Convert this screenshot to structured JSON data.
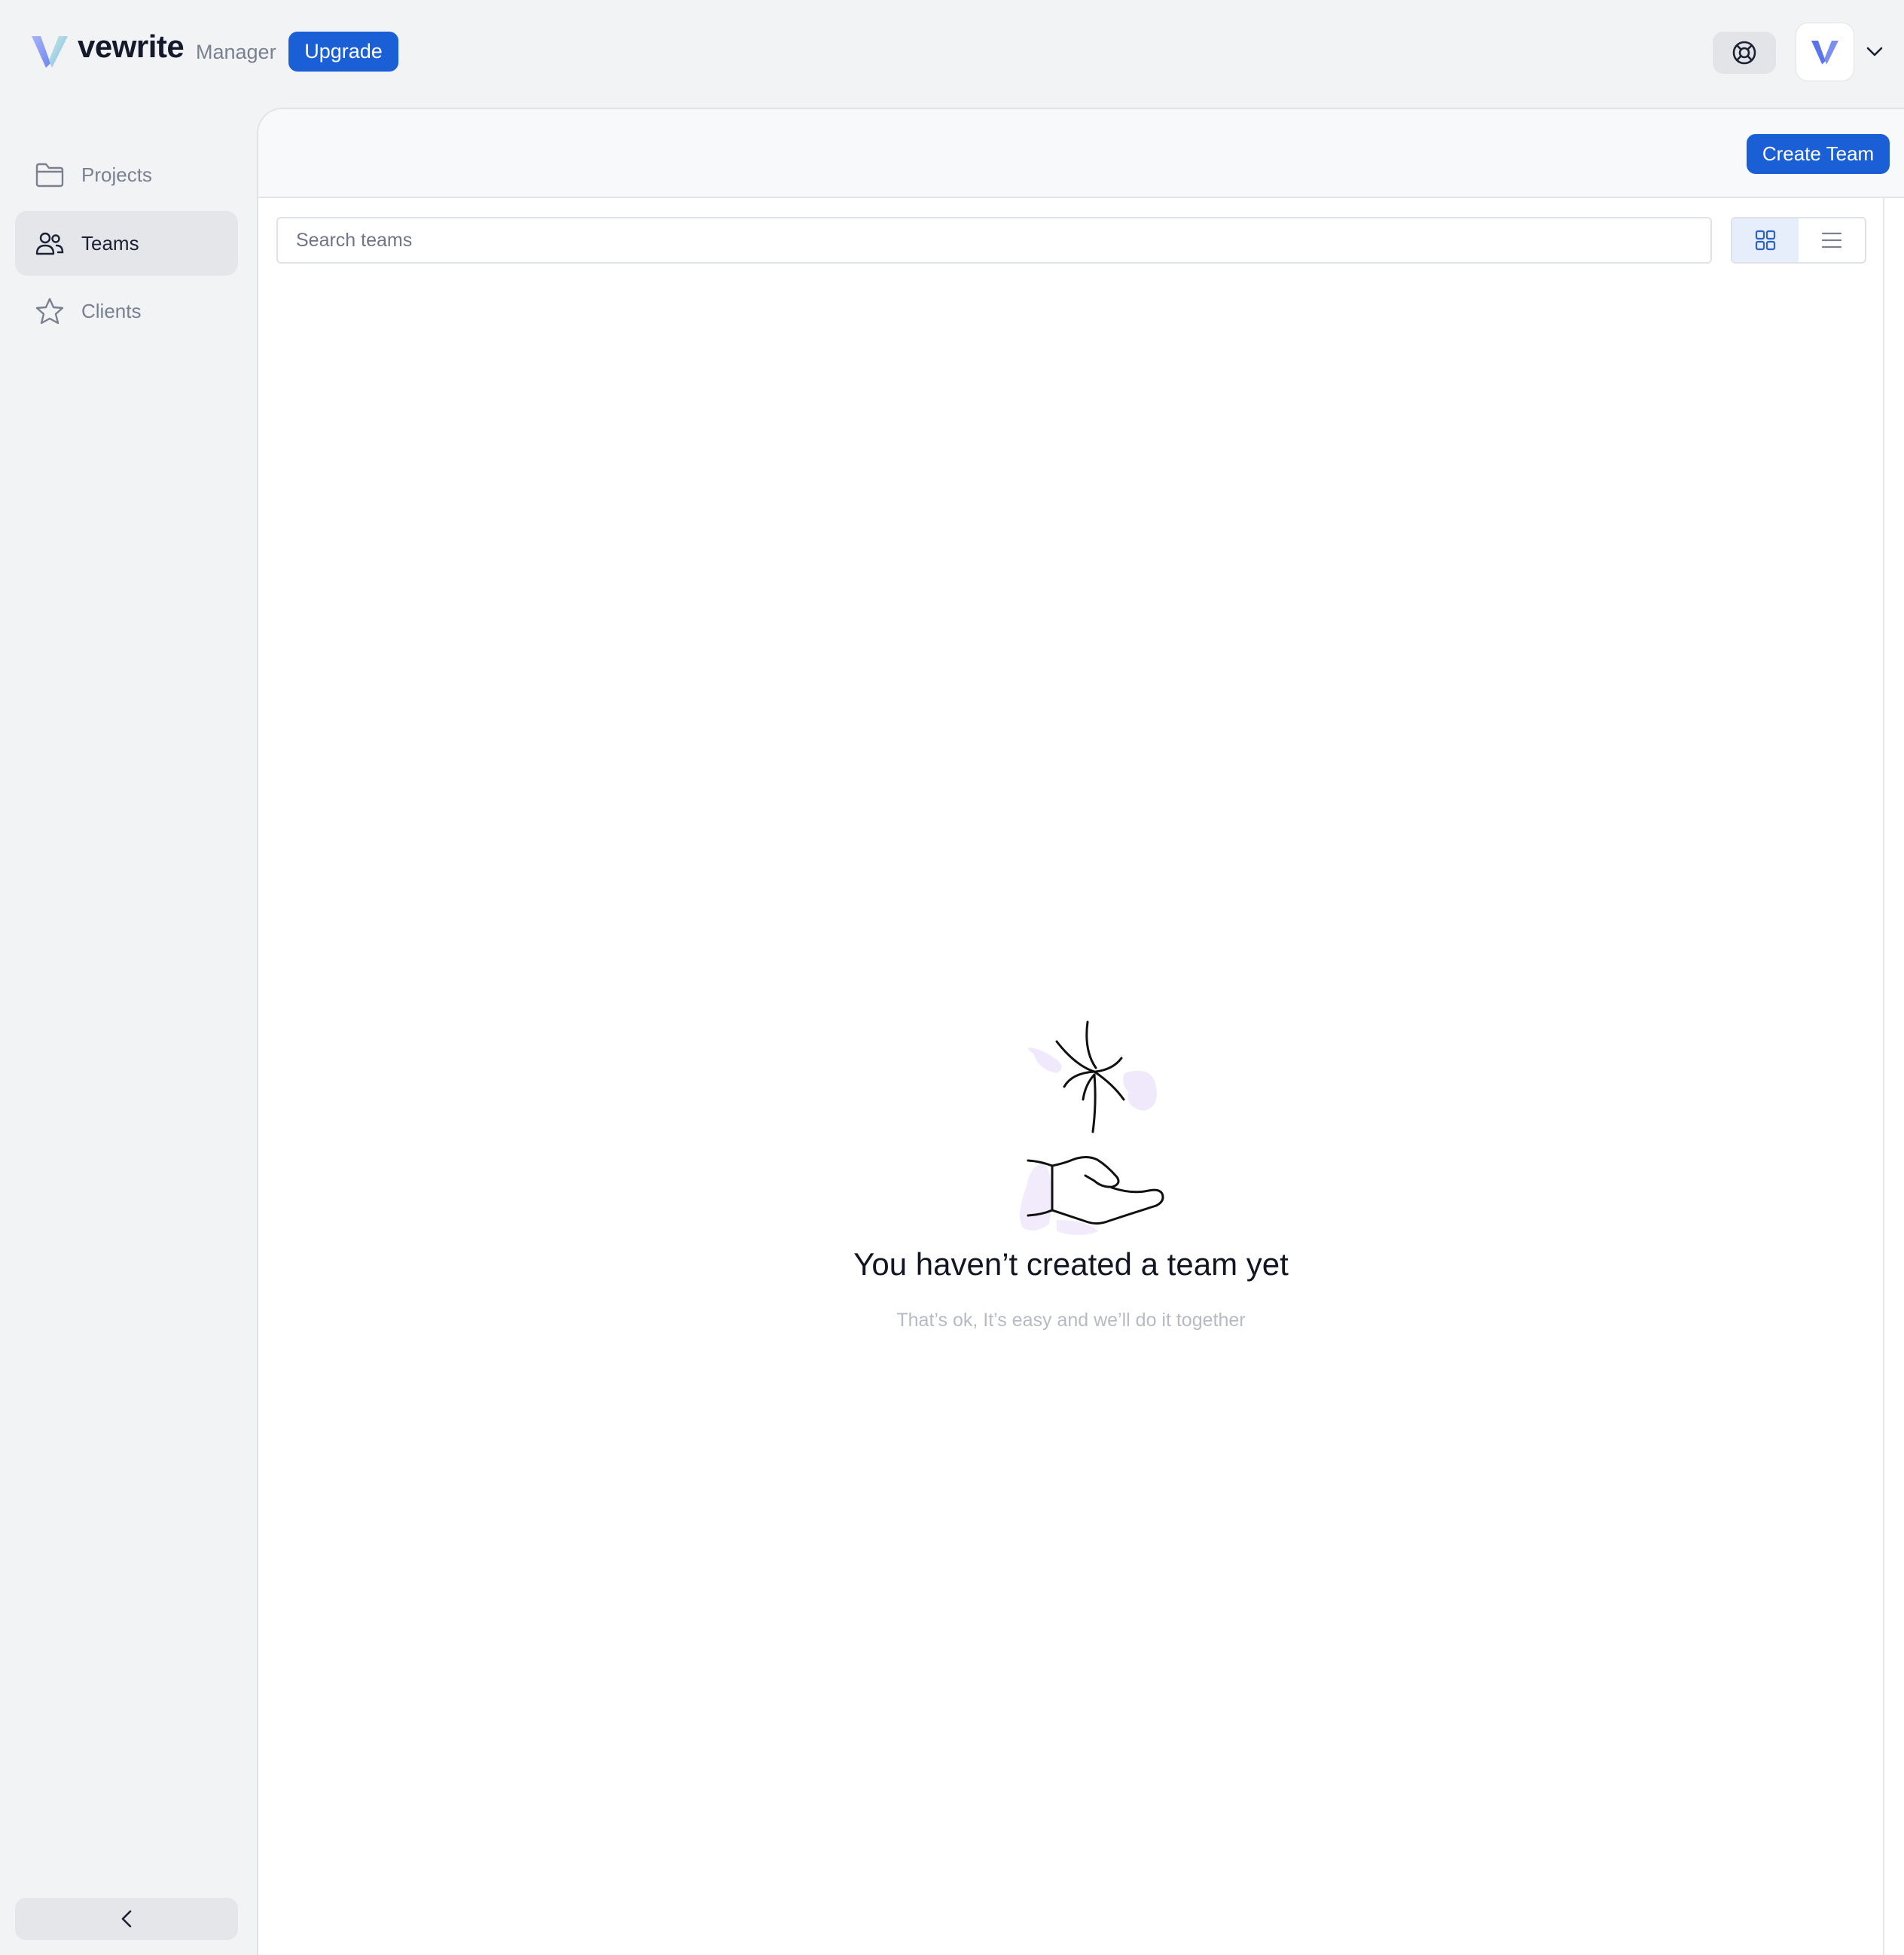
{
  "header": {
    "brand": "vewrite",
    "role": "Manager",
    "upgrade_label": "Upgrade",
    "help_icon": "lifebuoy-icon",
    "account_menu_icon": "chevron-down-icon",
    "colors": {
      "primary": "#1a5fd6",
      "logo_gradient": [
        "#8b9cf5",
        "#7dd3c0"
      ]
    }
  },
  "sidebar": {
    "items": [
      {
        "label": "Projects",
        "icon": "folder-icon",
        "active": false
      },
      {
        "label": "Teams",
        "icon": "users-icon",
        "active": true
      },
      {
        "label": "Clients",
        "icon": "star-icon",
        "active": false
      }
    ],
    "collapse_icon": "chevron-left-icon"
  },
  "main": {
    "create_label": "Create Team",
    "search": {
      "placeholder": "Search teams",
      "value": ""
    },
    "view_modes": [
      {
        "name": "grid",
        "icon": "grid-icon",
        "active": true
      },
      {
        "name": "list",
        "icon": "list-icon",
        "active": false
      }
    ],
    "empty_state": {
      "title": "You haven’t created a team yet",
      "subtitle": "That’s ok, It’s easy and we’ll do it together"
    }
  }
}
